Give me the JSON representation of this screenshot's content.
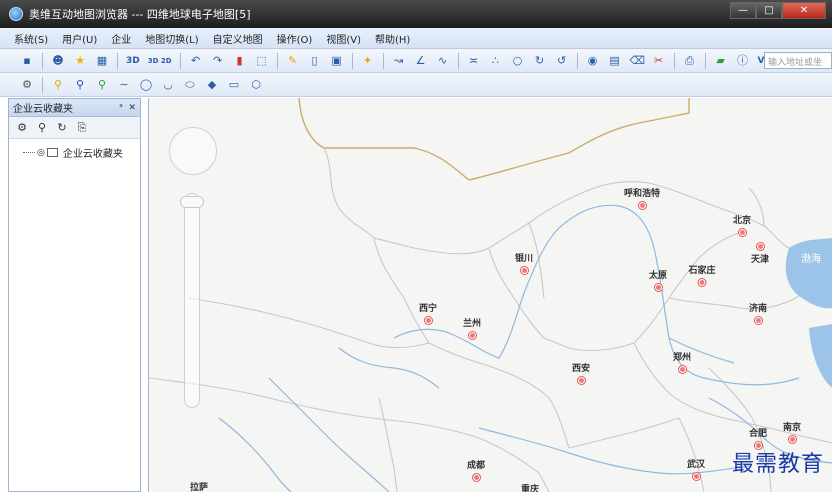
{
  "window": {
    "title": "奥维互动地图浏览器 --- 四维地球电子地图[5]",
    "minimize": "—",
    "maximize": "□",
    "close": "✕"
  },
  "menu": [
    "系统(S)",
    "用户(U)",
    "企业",
    "地图切换(L)",
    "自定义地图",
    "操作(O)",
    "视图(V)",
    "帮助(H)"
  ],
  "toolbar": {
    "btn_3d": "3D",
    "btn_2d3d": "3D 2D",
    "vip": "VIP",
    "search_placeholder": "输入地址或坐"
  },
  "panel": {
    "title": "企业云收藏夹",
    "pin": "ᵃ",
    "close": "✕",
    "tree_item": "企业云收藏夹"
  },
  "map": {
    "cities": [
      {
        "name": "呼和浩特"
      },
      {
        "name": "北京"
      },
      {
        "name": "天津"
      },
      {
        "name": "银川"
      },
      {
        "name": "太原"
      },
      {
        "name": "石家庄"
      },
      {
        "name": "济南"
      },
      {
        "name": "西宁"
      },
      {
        "name": "兰州"
      },
      {
        "name": "西安"
      },
      {
        "name": "郑州"
      },
      {
        "name": "合肥"
      },
      {
        "name": "南京"
      },
      {
        "name": "武汉"
      },
      {
        "name": "成都"
      },
      {
        "name": "重庆"
      },
      {
        "name": "拉萨"
      }
    ],
    "sea_label": "渤海",
    "watermark": "最需教育"
  },
  "colors": {
    "title_bar": "#2a2a2a",
    "menu_bg": "#dfe9f6",
    "map_bg": "#f5f5f3",
    "water": "#9cc3e8",
    "river": "#8fb8e0",
    "border": "#c8c8c8",
    "national_border": "#c9ad6a",
    "city_dot": "#f07878"
  }
}
